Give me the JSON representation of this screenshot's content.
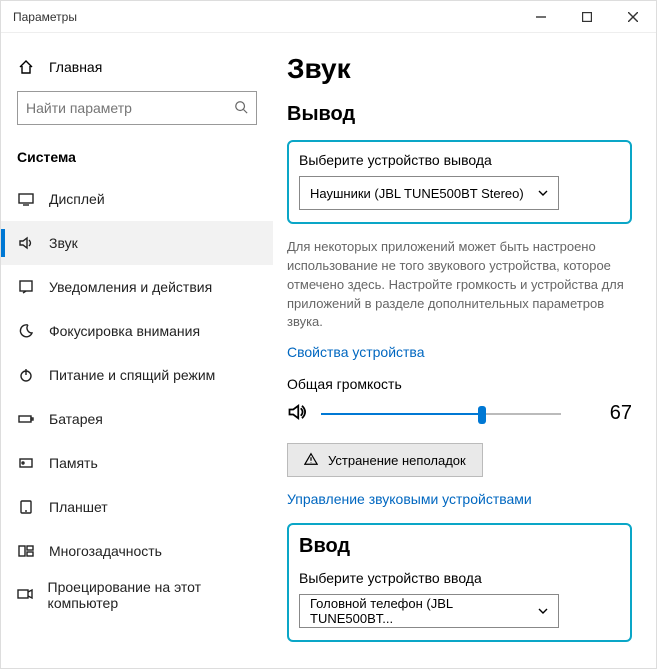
{
  "window": {
    "title": "Параметры"
  },
  "sidebar": {
    "home": "Главная",
    "search_placeholder": "Найти параметр",
    "section": "Система",
    "items": [
      {
        "label": "Дисплей"
      },
      {
        "label": "Звук"
      },
      {
        "label": "Уведомления и действия"
      },
      {
        "label": "Фокусировка внимания"
      },
      {
        "label": "Питание и спящий режим"
      },
      {
        "label": "Батарея"
      },
      {
        "label": "Память"
      },
      {
        "label": "Планшет"
      },
      {
        "label": "Многозадачность"
      },
      {
        "label": "Проецирование на этот компьютер"
      }
    ],
    "active_index": 1
  },
  "main": {
    "page_title": "Звук",
    "output": {
      "heading": "Вывод",
      "select_label": "Выберите устройство вывода",
      "selected": "Наушники (JBL TUNE500BT Stereo)",
      "help": "Для некоторых приложений может быть настроено использование не того звукового устройства, которое отмечено здесь. Настройте громкость и устройства для приложений в разделе дополнительных параметров звука.",
      "props_link": "Свойства устройства",
      "volume_label": "Общая громкость",
      "volume_value": "67",
      "troubleshoot": "Устранение неполадок",
      "manage_link": "Управление звуковыми устройствами"
    },
    "input": {
      "heading": "Ввод",
      "select_label": "Выберите устройство ввода",
      "selected": "Головной телефон (JBL TUNE500BT..."
    }
  }
}
